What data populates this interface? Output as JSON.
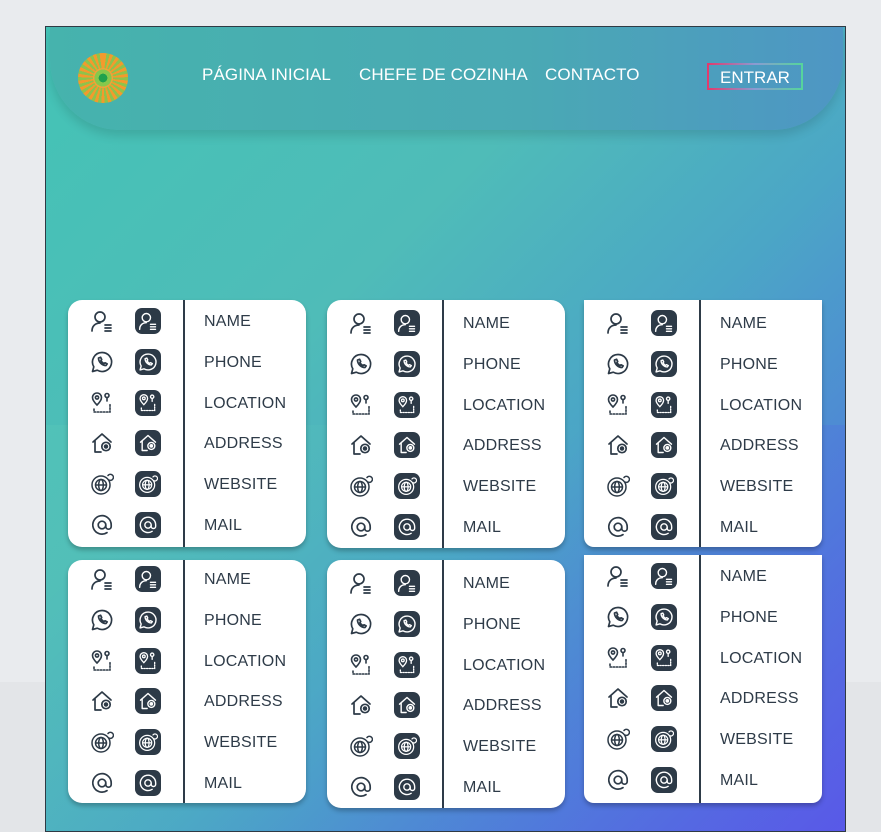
{
  "header": {
    "logo_name": "logo",
    "nav": [
      {
        "label": "PÁGINA INICIAL"
      },
      {
        "label": "CHEFE DE COZINHA"
      },
      {
        "label": "CONTACTO"
      }
    ],
    "login_label": "ENTRAR"
  },
  "cards": [
    {
      "rows": [
        "NAME",
        "PHONE",
        "LOCATION",
        "ADDRESS",
        "WEBSITE",
        "MAIL"
      ]
    },
    {
      "rows": [
        "NAME",
        "PHONE",
        "LOCATION",
        "ADDRESS",
        "WEBSITE",
        "MAIL"
      ]
    },
    {
      "rows": [
        "NAME",
        "PHONE",
        "LOCATION",
        "ADDRESS",
        "WEBSITE",
        "MAIL"
      ]
    },
    {
      "rows": [
        "NAME",
        "PHONE",
        "LOCATION",
        "ADDRESS",
        "WEBSITE",
        "MAIL"
      ]
    },
    {
      "rows": [
        "NAME",
        "PHONE",
        "LOCATION",
        "ADDRESS",
        "WEBSITE",
        "MAIL"
      ]
    },
    {
      "rows": [
        "NAME",
        "PHONE",
        "LOCATION",
        "ADDRESS",
        "WEBSITE",
        "MAIL"
      ]
    }
  ],
  "icons": [
    "user-icon",
    "whatsapp-icon",
    "location-icon",
    "home-pin-icon",
    "globe-icon",
    "at-icon"
  ],
  "colors": {
    "icon": "#2d3a47",
    "card": "#ffffff",
    "accent_start": "#44c3b6",
    "accent_end": "#5b5ee6"
  }
}
